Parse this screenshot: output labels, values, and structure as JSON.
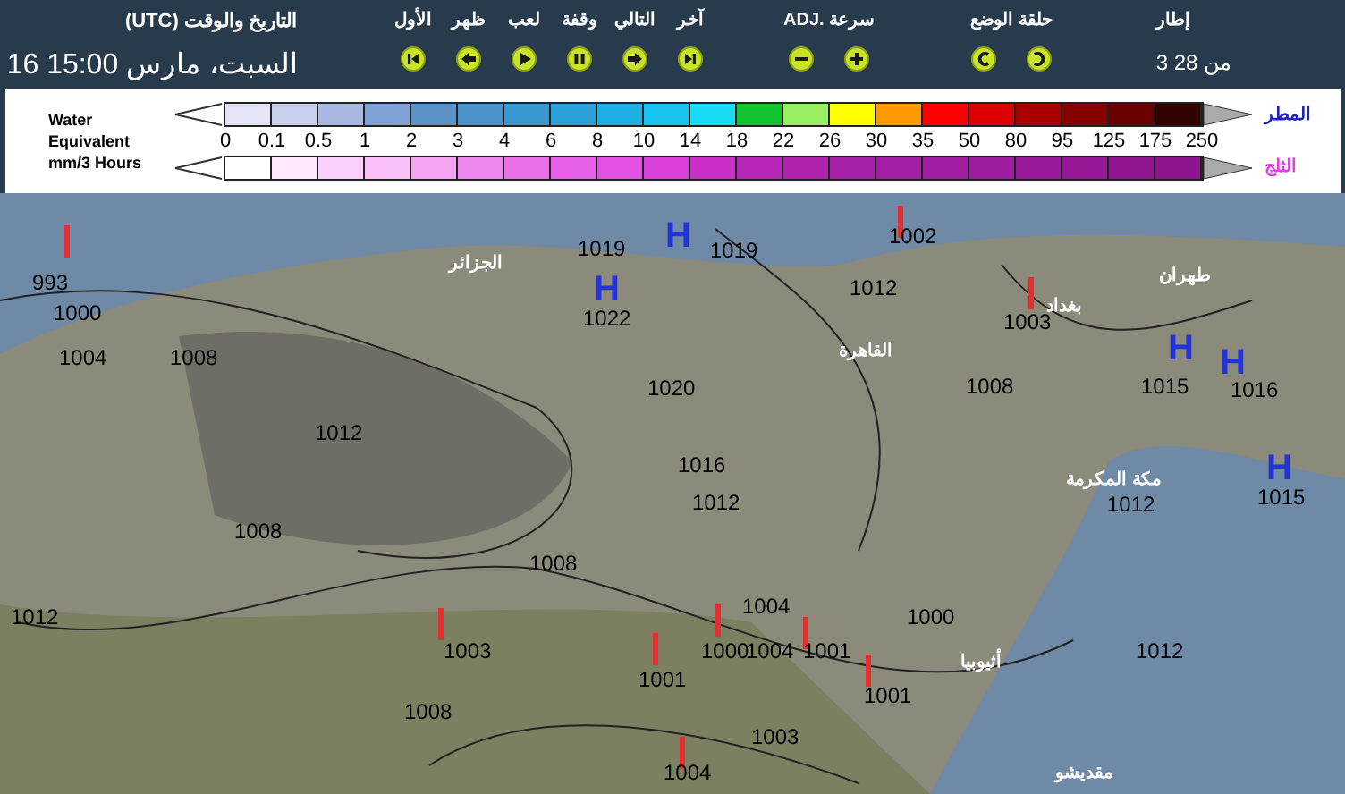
{
  "header": {
    "frame": {
      "label": "إطار",
      "value": "من 28 3"
    },
    "loop": {
      "label": "حلقة الوضع",
      "buttons": [
        {
          "kind": "loop_right"
        },
        {
          "kind": "loop_left"
        }
      ]
    },
    "speed": {
      "label": "ADJ. سرعة",
      "buttons": [
        {
          "kind": "plus"
        },
        {
          "kind": "minus"
        }
      ]
    },
    "playback": [
      {
        "label": "آخر",
        "kind": "last"
      },
      {
        "label": "التالي",
        "kind": "next"
      },
      {
        "label": "وقفة",
        "kind": "pause"
      },
      {
        "label": "لعب",
        "kind": "play"
      },
      {
        "label": "ظهر",
        "kind": "back"
      },
      {
        "label": "الأول",
        "kind": "first"
      }
    ],
    "datetime_label": "(UTC) التاريخ والوقت",
    "datetime": "السبت، مارس 15:00 16"
  },
  "legend": {
    "title_lines": [
      "Water",
      "Equivalent",
      "mm/3 Hours"
    ],
    "ticks": [
      "250",
      "175",
      "125",
      "95",
      "80",
      "50",
      "35",
      "30",
      "26",
      "22",
      "18",
      "14",
      "10",
      "8",
      "6",
      "4",
      "3",
      "2",
      "1",
      "0.5",
      "0.1",
      "0"
    ],
    "rain_label": "المطر",
    "snow_label": "الثلج"
  },
  "map": {
    "highs": [
      {
        "text": "H"
      },
      {
        "text": "H"
      },
      {
        "text": "H"
      },
      {
        "text": "H"
      },
      {
        "text": "H"
      }
    ],
    "cities": [
      {
        "name": "طهران"
      },
      {
        "name": "الجزائر"
      },
      {
        "name": "بغداد"
      },
      {
        "name": "القاهرة"
      },
      {
        "name": "مكة المكرمة"
      },
      {
        "name": "أثيوبيا"
      },
      {
        "name": "مقديشو"
      }
    ],
    "isobars": [
      {
        "text": "1002"
      },
      {
        "text": "1019"
      },
      {
        "text": "1019"
      },
      {
        "text": "1012"
      },
      {
        "text": "993"
      },
      {
        "text": "1003"
      },
      {
        "text": "1022"
      },
      {
        "text": "1000"
      },
      {
        "text": "1008"
      },
      {
        "text": "1004"
      },
      {
        "text": "1016"
      },
      {
        "text": "1015"
      },
      {
        "text": "1008"
      },
      {
        "text": "1020"
      },
      {
        "text": "1012"
      },
      {
        "text": "1016"
      },
      {
        "text": "1015"
      },
      {
        "text": "1012"
      },
      {
        "text": "1012"
      },
      {
        "text": "1008"
      },
      {
        "text": "1008"
      },
      {
        "text": "1000"
      },
      {
        "text": "1004"
      },
      {
        "text": "1012"
      },
      {
        "text": "1012"
      },
      {
        "text": "1001"
      },
      {
        "text": "1004"
      },
      {
        "text": "1000"
      },
      {
        "text": "1003"
      },
      {
        "text": "1001"
      },
      {
        "text": "1001"
      },
      {
        "text": "1008"
      },
      {
        "text": "1003"
      },
      {
        "text": "1004"
      }
    ]
  }
}
